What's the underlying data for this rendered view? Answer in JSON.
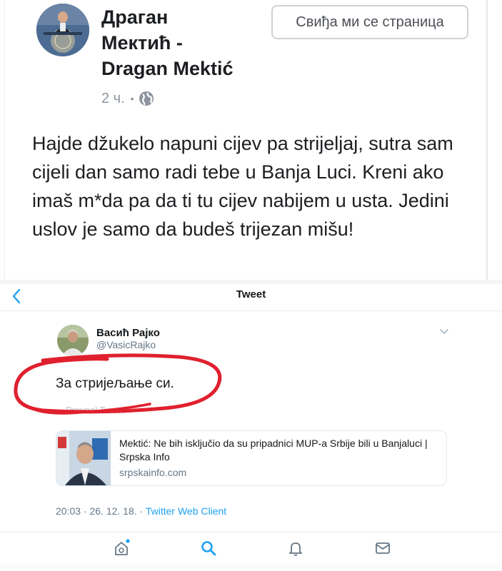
{
  "facebook": {
    "page_name_line1": "Драган",
    "page_name_line2": "Мектић -",
    "page_name_line3": "Dragan Mektić",
    "like_button": "Свиђа ми се страница",
    "time": "2 ч.",
    "meta_dot": "•",
    "globe_icon": "globe-icon",
    "post_text": "Hajde džukelo napuni cijev pa strijeljaj, sutra sam cijeli dan samo radi tebe u Banja Luci. Kreni ako imaš m*da pa da ti  tu cijev nabijem u usta. Jedini uslov je samo da budeš trijezan mišu!"
  },
  "twitter": {
    "header_title": "Tweet",
    "back_icon": "back-chevron-icon",
    "user_name": "Васић Рајко",
    "user_handle": "@VasicRajko",
    "tweet_text": "За стријељање си.",
    "reply_ghost": "Preveal Tweet",
    "card": {
      "title": "Mektić: Ne bih isključio da su pripadnici MUP-a Srbije bili u Banjaluci | Srpska Info",
      "domain": "srpskainfo.com"
    },
    "timestamp": "20:03 · 26. 12. 18. · ",
    "client": "Twitter Web Client",
    "tabs": [
      "home-icon",
      "search-icon",
      "notifications-icon",
      "messages-icon"
    ],
    "accent": "#1da1f2",
    "annotation_color": "#e0202e"
  }
}
